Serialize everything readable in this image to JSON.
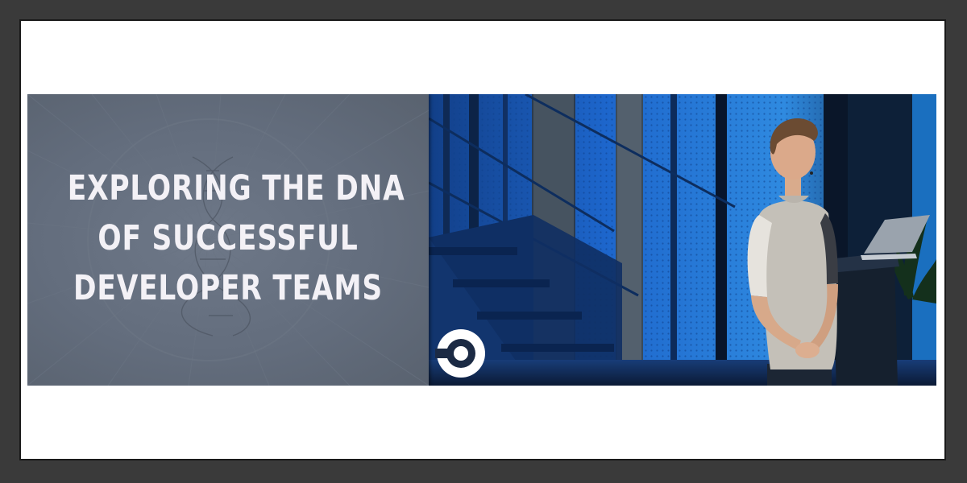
{
  "slide": {
    "title_lines": [
      "EXPLORING THE DNA",
      "OF SUCCESSFUL",
      "DEVELOPER TEAMS"
    ],
    "background_color": "#636d7d",
    "text_color": "#f3f1f6"
  },
  "photo": {
    "subject": "speaker on stage beside a podium with laptop",
    "palette": {
      "blue": "#1d63c9",
      "dark": "#0c1a33",
      "shirt": "#c9c4bc"
    }
  },
  "logo": {
    "icon": "circleci-logo-icon",
    "color": "#ffffff"
  }
}
